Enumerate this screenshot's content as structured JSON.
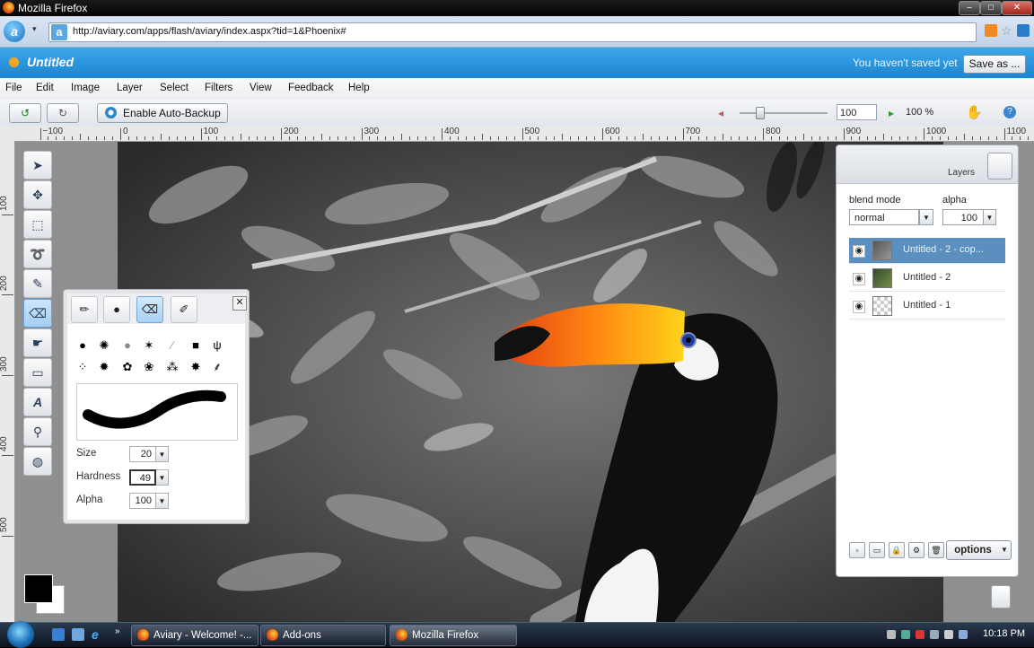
{
  "window": {
    "title": "Mozilla Firefox"
  },
  "browser": {
    "url": "http://aviary.com/apps/flash/aviary/index.aspx?tid=1&Phoenix#"
  },
  "app": {
    "doc_title": "Untitled",
    "save_status": "You haven't saved yet",
    "save_as_label": "Save as ..."
  },
  "menu": [
    "File",
    "Edit",
    "Image",
    "Layer",
    "Select",
    "Filters",
    "View",
    "Feedback",
    "Help"
  ],
  "toolbar": {
    "autobackup_label": "Enable Auto-Backup",
    "zoom_value": "100",
    "zoom_percent": "100 %"
  },
  "rulers": {
    "top": [
      "−100",
      "0",
      "100",
      "200",
      "300",
      "400",
      "500",
      "600",
      "700",
      "800",
      "900",
      "1000",
      "1100"
    ],
    "left": [
      "100",
      "200",
      "300",
      "400",
      "500"
    ]
  },
  "brush_panel": {
    "size_label": "Size",
    "size_value": "20",
    "hardness_label": "Hardness",
    "hardness_value": "49",
    "alpha_label": "Alpha",
    "alpha_value": "100"
  },
  "layers_panel": {
    "title": "Layers",
    "blend_mode_label": "blend mode",
    "blend_mode_value": "normal",
    "alpha_label": "alpha",
    "alpha_value": "100",
    "layers": [
      {
        "name": "Untitled - 2 - cop...",
        "selected": true
      },
      {
        "name": "Untitled - 2",
        "selected": false
      },
      {
        "name": "Untitled - 1",
        "selected": false
      }
    ],
    "options_label": "options"
  },
  "taskbar": {
    "tasks": [
      "Aviary - Welcome! -...",
      "Add-ons",
      "Mozilla Firefox"
    ],
    "clock": "10:18 PM"
  },
  "icons": {
    "tools": [
      "pointer-icon",
      "move-icon",
      "marquee-icon",
      "lasso-icon",
      "brush-icon",
      "eraser-icon",
      "smudge-icon",
      "shape-icon",
      "text-icon",
      "zoom-icon",
      "paint-bucket-icon"
    ]
  }
}
